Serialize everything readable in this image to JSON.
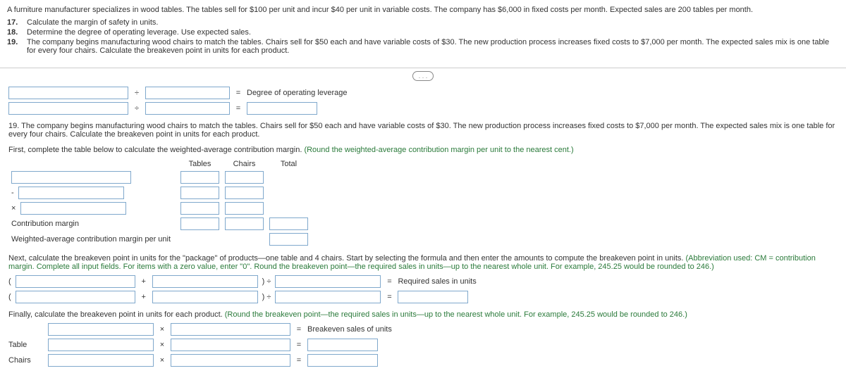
{
  "intro": "A furniture manufacturer specializes in wood tables. The tables sell for $100 per unit and incur $40 per unit in variable costs. The company has $6,000 in fixed costs per month. Expected sales are 200 tables per month.",
  "questions": [
    {
      "num": "17.",
      "text": "Calculate the margin of safety in units."
    },
    {
      "num": "18.",
      "text": "Determine the degree of operating leverage. Use expected sales."
    },
    {
      "num": "19.",
      "text": "The company begins manufacturing wood chairs to match the tables. Chairs sell for $50 each and have variable costs of $30. The new production process increases fixed costs to $7,000 per month. The expected sales mix is one table for every four chairs. Calculate the breakeven point in units for each product."
    }
  ],
  "pager": ". . .",
  "dol": {
    "equals1": "=",
    "result_label": "Degree of operating leverage",
    "div": "÷",
    "equals2": "="
  },
  "q19header": "19. The company begins manufacturing wood chairs to match the tables. Chairs sell for $50 each and have variable costs of $30. The new production process increases fixed costs to $7,000 per month. The expected sales mix is one table for every four chairs. Calculate the breakeven point in units for each product.",
  "cmtable": {
    "intro_black": "First, complete the table below to calculate the weighted-average contribution margin. ",
    "intro_green": "(Round the weighted-average contribution margin per unit to the nearest cent.)",
    "head_tables": "Tables",
    "head_chairs": "Chairs",
    "head_total": "Total",
    "minus": "-",
    "times": "×",
    "cm_label": "Contribution margin",
    "wacm_label": "Weighted-average contribution margin per unit"
  },
  "pkg": {
    "intro_black": "Next, calculate the breakeven point in units for the \"package\" of products—one table and 4 chairs. Start by selecting the formula and then enter the amounts to compute the breakeven point in units. ",
    "intro_green": "(Abbreviation used: CM = contribution margin. Complete all input fields. For items with a zero value, enter \"0\". Round the breakeven point—the required sales in units—up to the nearest whole unit. For example, 245.25 would be rounded to 246.)",
    "lparen": "(",
    "plus": "+",
    "rparen_div": ") ÷",
    "equals": "=",
    "result_label": "Required sales in units"
  },
  "final": {
    "intro_black": "Finally, calculate the breakeven point in units for each product. ",
    "intro_green": "(Round the breakeven point—the required sales in units—up to the nearest whole unit. For example, 245.25 would be rounded to 246.)",
    "times": "×",
    "equals": "=",
    "result_label": "Breakeven sales of units",
    "table_label": "Table",
    "chairs_label": "Chairs"
  }
}
